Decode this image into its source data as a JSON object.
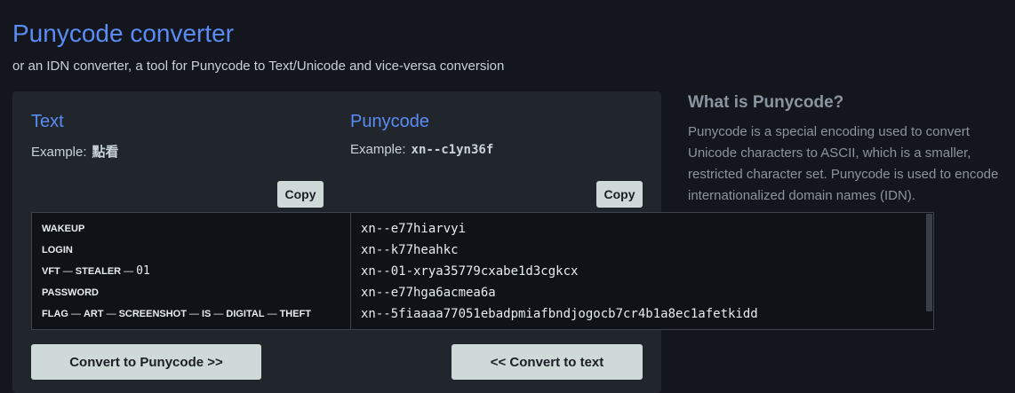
{
  "header": {
    "title": "Punycode converter",
    "subtitle": "or an IDN converter, a tool for Punycode to Text/Unicode and vice-versa conversion"
  },
  "text_col": {
    "heading": "Text",
    "example_label": "Example:",
    "example_value": "點看",
    "copy_label": "Copy"
  },
  "puny_col": {
    "heading": "Punycode",
    "example_label": "Example:",
    "example_value": "xn--c1yn36f",
    "copy_label": "Copy"
  },
  "text_lines": [
    {
      "parts": [
        "WAKEUP"
      ]
    },
    {
      "parts": [
        "LOGIN"
      ]
    },
    {
      "parts": [
        "VFT",
        "STEALER",
        "01"
      ]
    },
    {
      "parts": [
        "PASSWORD"
      ]
    },
    {
      "parts": [
        "FLAG",
        "ART",
        "SCREENSHOT",
        "IS",
        "DIGITAL",
        "THEFT"
      ]
    }
  ],
  "separator": "—",
  "punycode_lines": [
    "xn--e77hiarvyi",
    "xn--k77heahkc",
    "xn--01-xrya35779cxabe1d3cgkcx",
    "xn--e77hga6acmea6a",
    "xn--5fiaaaa77051ebadpmiafbndjogocb7cr4b1a8ec1afetkidd"
  ],
  "actions": {
    "to_punycode": "Convert to Punycode >>",
    "to_text": "<< Convert to text"
  },
  "sidebar": {
    "heading": "What is Punycode?",
    "body": "Punycode is a special encoding used to convert Unicode characters to ASCII, which is a smaller, restricted character set. Punycode is used to encode internationalized domain names (IDN)."
  },
  "colors": {
    "accent": "#5b8cf5",
    "panel": "#21262d",
    "button": "#cfdad8"
  }
}
